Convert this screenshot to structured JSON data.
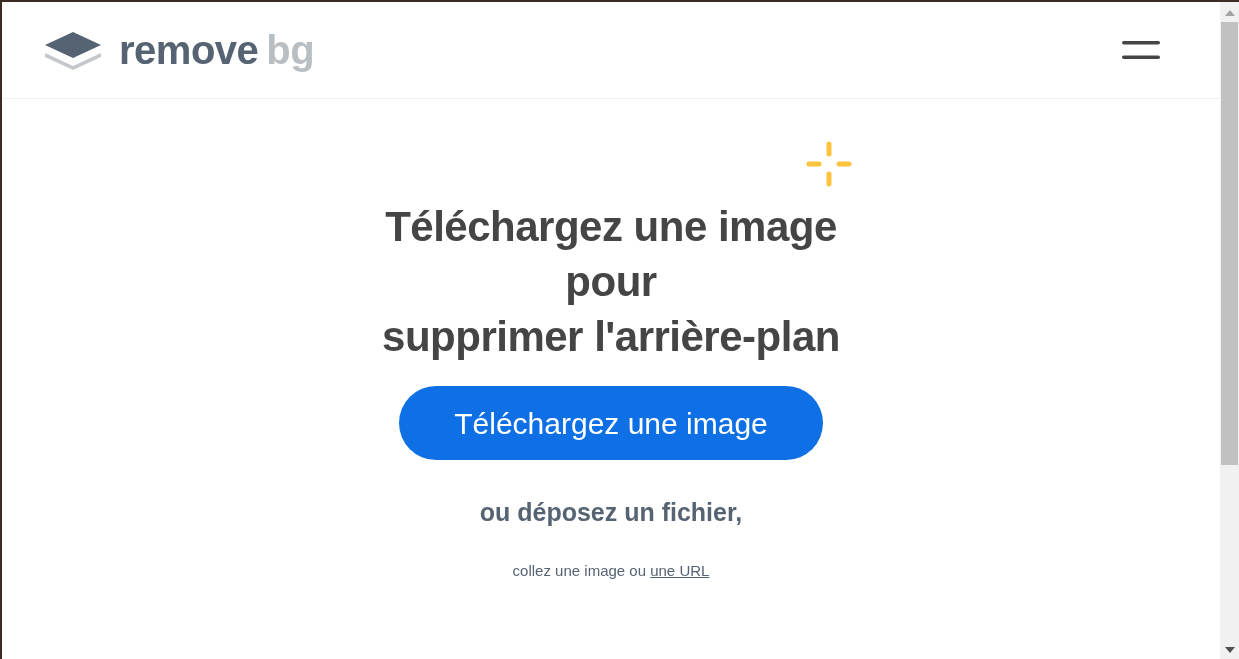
{
  "header": {
    "logo": {
      "primary": "remove",
      "secondary": "bg"
    }
  },
  "hero": {
    "heading_lines": [
      "Téléchargez une image",
      "pour",
      "supprimer l'arrière-plan"
    ],
    "upload_button": "Téléchargez une image",
    "drop_hint": "ou déposez un fichier,",
    "paste_hint": "collez une image ou",
    "url_link": "une URL"
  }
}
